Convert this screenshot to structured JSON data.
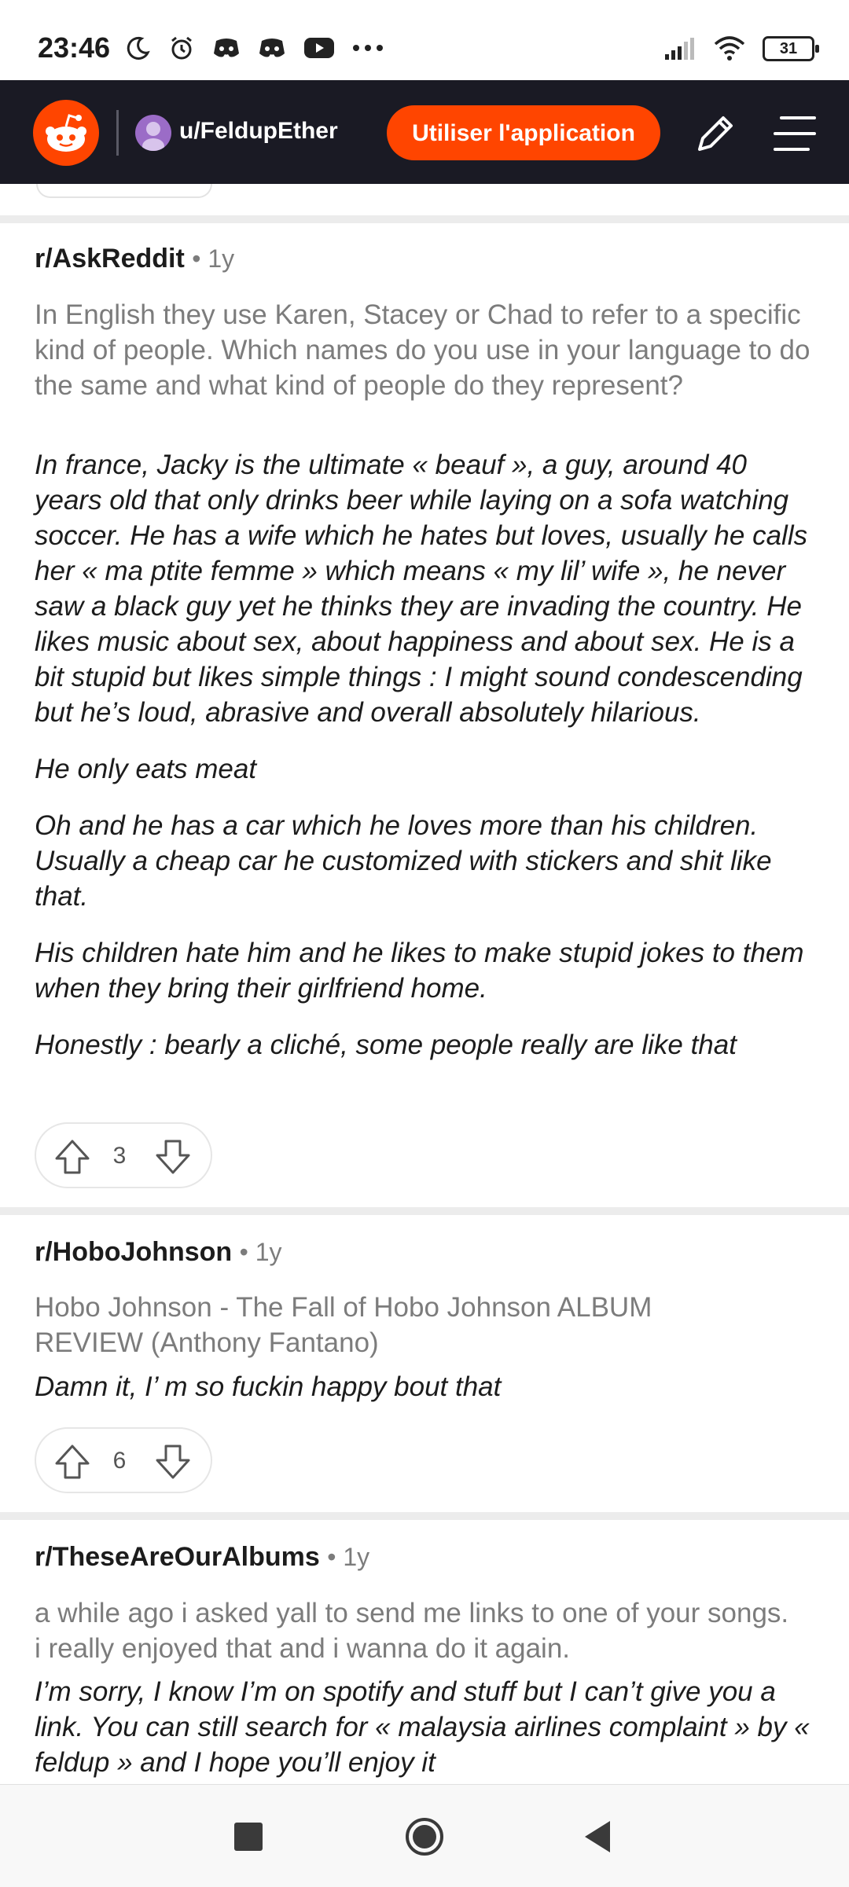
{
  "status_bar": {
    "time": "23:46",
    "icons": [
      "moon-icon",
      "alarm-icon",
      "discord-icon",
      "discord-icon",
      "youtube-icon",
      "more-icon"
    ],
    "battery": "31"
  },
  "header": {
    "username": "u/FeldupEther",
    "open_app_label": "Utiliser l'application",
    "brand_color": "#ff4500"
  },
  "feed": [
    {
      "subreddit": "r/AskReddit",
      "age": "• 1y",
      "post_title": "In English they use Karen, Stacey or Chad to refer to a specific kind of people. Which names do you use in your language to do the same and what kind of people do they represent?",
      "comment_paragraphs": [
        "In france, Jacky is the ultimate « beauf », a guy, around 40 years old that only drinks beer while laying on a sofa watching soccer. He has a wife which he hates but loves, usually he calls her « ma ptite femme » which means « my lil’ wife », he never saw a black guy yet he thinks they are invading the country. He likes music about sex, about happiness and about sex. He is a bit stupid but likes simple things : I might sound condescending but he’s loud, abrasive and overall absolutely hilarious.",
        "He only eats meat",
        "Oh and he has a car which he loves more than his children. Usually a cheap car he customized with stickers and shit like that.",
        "His children hate him and he likes to make stupid jokes to them when they bring their girlfriend home.",
        "Honestly : bearly a cliché, some people really are like that"
      ],
      "score": "3"
    },
    {
      "subreddit": "r/HoboJohnson",
      "age": "• 1y",
      "post_title": "Hobo Johnson - The Fall of Hobo Johnson ALBUM REVIEW (Anthony Fantano)",
      "comment_paragraphs": [
        "Damn it, I’ m so fuckin happy bout that"
      ],
      "score": "6"
    },
    {
      "subreddit": "r/TheseAreOurAlbums",
      "age": "• 1y",
      "post_title": "a while ago i asked yall to send me links to one of your songs. i really enjoyed that and i wanna do it again.",
      "comment_paragraphs": [
        "I’m sorry, I know I’m on spotify and stuff but I can’t give you a link. You can still search for « malaysia airlines complaint » by « feldup » and I hope you’ll enjoy it"
      ]
    }
  ],
  "nav_bar": {
    "icons": [
      "recents-icon",
      "home-icon",
      "back-icon"
    ]
  }
}
